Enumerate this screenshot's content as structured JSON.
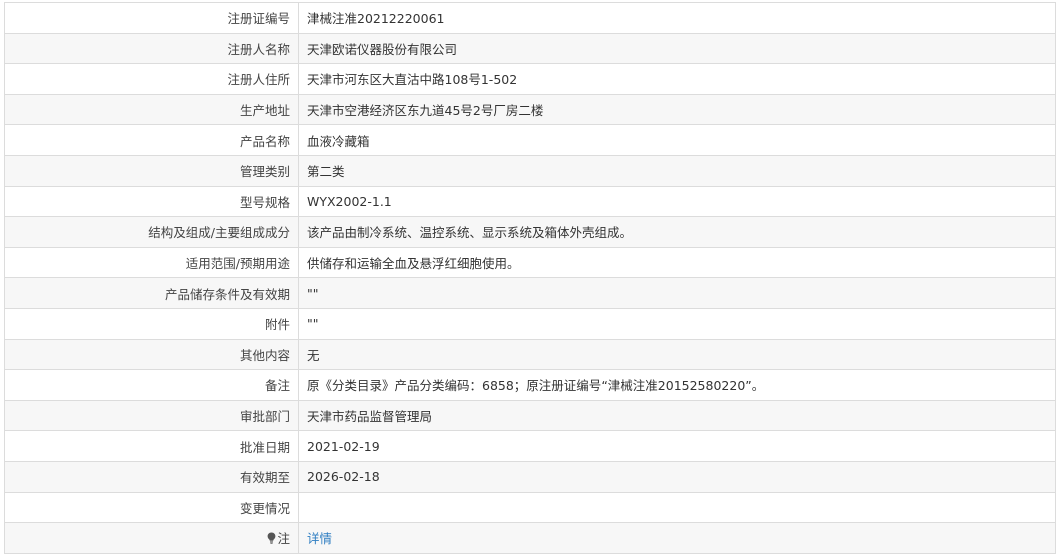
{
  "rows": [
    {
      "label": "注册证编号",
      "value": "津械注准20212220061"
    },
    {
      "label": "注册人名称",
      "value": "天津欧诺仪器股份有限公司"
    },
    {
      "label": "注册人住所",
      "value": "天津市河东区大直沽中路108号1-502"
    },
    {
      "label": "生产地址",
      "value": "天津市空港经济区东九道45号2号厂房二楼"
    },
    {
      "label": "产品名称",
      "value": "血液冷藏箱"
    },
    {
      "label": "管理类别",
      "value": "第二类"
    },
    {
      "label": "型号规格",
      "value": "WYX2002-1.1"
    },
    {
      "label": "结构及组成/主要组成成分",
      "value": "该产品由制冷系统、温控系统、显示系统及箱体外壳组成。"
    },
    {
      "label": "适用范围/预期用途",
      "value": "供储存和运输全血及悬浮红细胞使用。"
    },
    {
      "label": "产品储存条件及有效期",
      "value": "\"\""
    },
    {
      "label": "附件",
      "value": "\"\""
    },
    {
      "label": "其他内容",
      "value": "无"
    },
    {
      "label": "备注",
      "value": "原《分类目录》产品分类编码：6858；原注册证编号“津械注准20152580220”。"
    },
    {
      "label": "审批部门",
      "value": "天津市药品监督管理局"
    },
    {
      "label": "批准日期",
      "value": "2021-02-19"
    },
    {
      "label": "有效期至",
      "value": "2026-02-18"
    },
    {
      "label": "变更情况",
      "value": ""
    }
  ],
  "note_row": {
    "label": "注",
    "icon": "lightbulb-icon",
    "link_text": "详情",
    "link_color": "#2f7ec2"
  }
}
